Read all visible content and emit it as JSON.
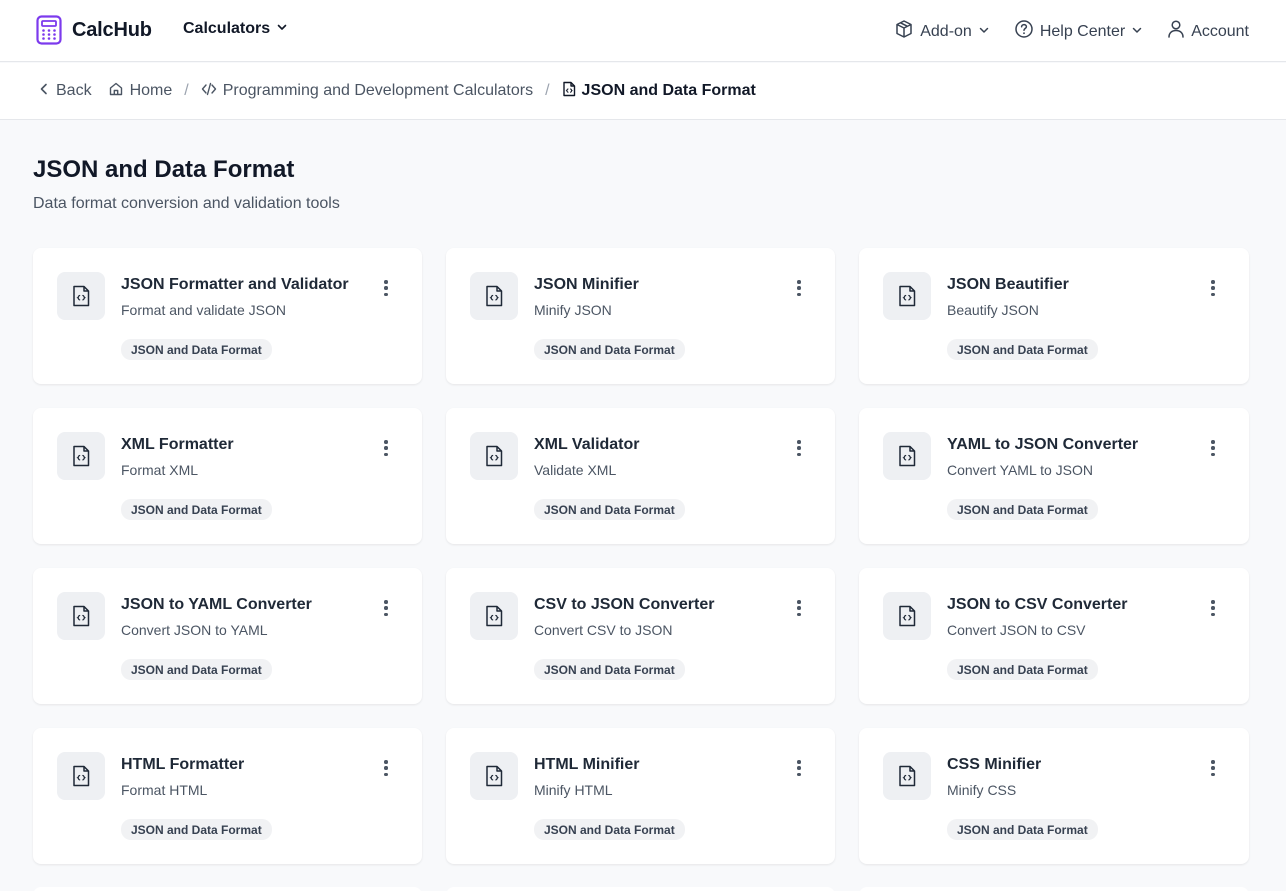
{
  "header": {
    "brand": "CalcHub",
    "calculators_label": "Calculators",
    "addon_label": "Add-on",
    "help_label": "Help Center",
    "account_label": "Account",
    "accent": "#7c3aed"
  },
  "breadcrumb": {
    "back": "Back",
    "home": "Home",
    "category": "Programming and Development Calculators",
    "current": "JSON and Data Format"
  },
  "page": {
    "title": "JSON and Data Format",
    "subtitle": "Data format conversion and validation tools"
  },
  "cards": [
    {
      "title": "JSON Formatter and Validator",
      "desc": "Format and validate JSON",
      "tag": "JSON and Data Format",
      "icon": "file-code-icon"
    },
    {
      "title": "JSON Minifier",
      "desc": "Minify JSON",
      "tag": "JSON and Data Format",
      "icon": "file-code-icon"
    },
    {
      "title": "JSON Beautifier",
      "desc": "Beautify JSON",
      "tag": "JSON and Data Format",
      "icon": "file-code-icon"
    },
    {
      "title": "XML Formatter",
      "desc": "Format XML",
      "tag": "JSON and Data Format",
      "icon": "file-code-icon"
    },
    {
      "title": "XML Validator",
      "desc": "Validate XML",
      "tag": "JSON and Data Format",
      "icon": "file-code-icon"
    },
    {
      "title": "YAML to JSON Converter",
      "desc": "Convert YAML to JSON",
      "tag": "JSON and Data Format",
      "icon": "file-code-icon"
    },
    {
      "title": "JSON to YAML Converter",
      "desc": "Convert JSON to YAML",
      "tag": "JSON and Data Format",
      "icon": "file-code-icon"
    },
    {
      "title": "CSV to JSON Converter",
      "desc": "Convert CSV to JSON",
      "tag": "JSON and Data Format",
      "icon": "file-code-icon"
    },
    {
      "title": "JSON to CSV Converter",
      "desc": "Convert JSON to CSV",
      "tag": "JSON and Data Format",
      "icon": "file-code-icon"
    },
    {
      "title": "HTML Formatter",
      "desc": "Format HTML",
      "tag": "JSON and Data Format",
      "icon": "file-code-icon"
    },
    {
      "title": "HTML Minifier",
      "desc": "Minify HTML",
      "tag": "JSON and Data Format",
      "icon": "file-code-icon"
    },
    {
      "title": "CSS Minifier",
      "desc": "Minify CSS",
      "tag": "JSON and Data Format",
      "icon": "file-code-icon"
    }
  ]
}
